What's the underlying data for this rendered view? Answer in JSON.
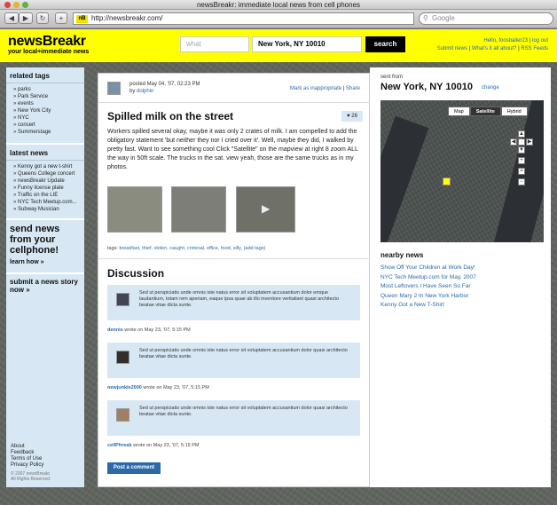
{
  "browser": {
    "window_title": "newsBreakr: immediate local news from cell phones",
    "url": "http://newsbreakr.com/",
    "favicon_text": "nB",
    "search_placeholder": "Google"
  },
  "header": {
    "logo": "newsBreakr",
    "tagline": "your local+immediate news",
    "what_placeholder": "what",
    "where_value": "New York, NY 10010",
    "search_label": "search",
    "greeting": "Hello, foosballer23",
    "logout": "log out",
    "submit_news": "Submit news",
    "about": "What's it all about?",
    "rss": "RSS Feeds"
  },
  "sidebar": {
    "related_tags_title": "related tags",
    "tags": [
      "parks",
      "Park Service",
      "events",
      "New York City",
      "NYC",
      "concert",
      "Summerstage"
    ],
    "latest_news_title": "latest news",
    "latest": [
      "Kenny got a new t-shirt",
      "Queens College concert",
      "newsBreakr Update",
      "Funny license plate",
      "Traffic on the LIE",
      "NYC Tech Meetup.com...",
      "Subway Musician"
    ],
    "cta_title": "send news from your cellphone!",
    "cta_link": "learn how »",
    "submit_title": "submit a news story now »",
    "footer_links": [
      "About",
      "Feedback",
      "Terms of Use",
      "Privacy Policy"
    ],
    "copyright": [
      "© 2007 newsBreakr.",
      "All Rights Reserved."
    ]
  },
  "post": {
    "posted": "posted May 04, '07, 02:23 PM",
    "by_prefix": "by",
    "author": "dolphin",
    "mark_inappropriate": "Mark as inappropriate",
    "share": "Share",
    "title": "Spilled milk on the street",
    "likes": "26",
    "body": "Workers spilled several okay, maybe it was only 2 crates of milk. I am compelled to add the obligatory statement 'but neither they nor I cried over it'. Well, maybe they did, I walked by pretty fast. Want to see something cool Click \"Satellite\" on the mapview at right 8 zoom ALL the way in 50ft scale. The trucks in the sat. view yeah, those are the same trucks as in my photos.",
    "tags_label": "tags:",
    "tags": "breakfast, thief, stolen, caught, criminal, office, food, silly, (add tags)"
  },
  "discussion": {
    "title": "Discussion",
    "comments": [
      {
        "text": "Sed ut perspiciatis unde omnis iste natus error sit voluptatem accusantium dolor emque laudantium, totam rem aperiam, eaque ipsa quae ab illo inventore veritatiset quasi architecto beatae vitae dicta sunte.",
        "user": "dennis",
        "meta": "wrote on May 23, '07, 5:15 PM"
      },
      {
        "text": "Sed ut perspiciatis unde omnis iste natus error sit voluptatem accusantium dolor quasi architecto beatae vitae dicta sunte.",
        "user": "newjunkie2000",
        "meta": "wrote on May 23, '07, 5:15 PM"
      },
      {
        "text": "Sed ut perspiciatis unde omnis iste natus error sit voluptatem accusantium dolor quasi architecto beatae vitae dicta sunte.",
        "user": "cellPhreak",
        "meta": "wrote on May 23, '07, 5:15 PM"
      }
    ],
    "post_button": "Post a comment"
  },
  "right": {
    "sent_from": "sent from",
    "location": "New York, NY 10010",
    "change": "change",
    "map_buttons": [
      "Map",
      "Satellite",
      "Hybrid"
    ],
    "selected_map": "Satellite",
    "nearby_title": "nearby news",
    "nearby": [
      "Show Off Your Children at Work Day!",
      "NYC Tech Meetup.com for May, 2007",
      "Most Leftovers I Have Seen So Far",
      "Queen Mary 2 In New York Harbor",
      "Kenny Got a New T-Shirt"
    ]
  }
}
